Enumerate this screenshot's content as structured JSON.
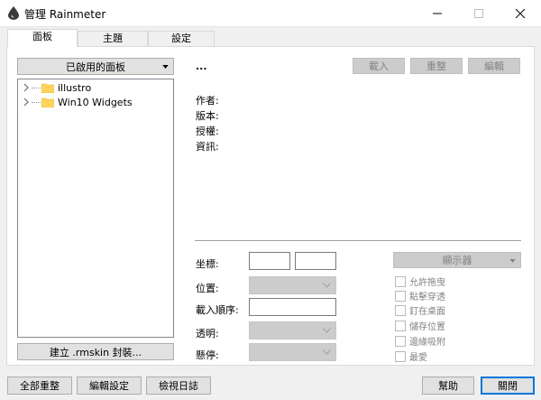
{
  "window": {
    "title": "管理 Rainmeter"
  },
  "tabs": [
    {
      "label": "面板"
    },
    {
      "label": "主題"
    },
    {
      "label": "設定"
    }
  ],
  "skins": {
    "dropdown_label": "已啟用的面板",
    "tree": [
      {
        "label": "illustro"
      },
      {
        "label": "Win10 Widgets"
      }
    ],
    "create_button": "建立 .rmskin 封裝..."
  },
  "details": {
    "name": "...",
    "load_button": "載入",
    "refresh_button": "重整",
    "edit_button": "編輯",
    "author_label": "作者:",
    "version_label": "版本:",
    "license_label": "授權:",
    "info_label": "資訊:"
  },
  "settings": {
    "coordinates_label": "坐標:",
    "position_label": "位置:",
    "load_order_label": "載入順序:",
    "transparency_label": "透明:",
    "hover_label": "懸停:",
    "display_label": "顯示器",
    "checkboxes": [
      {
        "label": "允許拖曳"
      },
      {
        "label": "點擊穿透"
      },
      {
        "label": "釘在桌面"
      },
      {
        "label": "儲存位置"
      },
      {
        "label": "邊緣吸附"
      },
      {
        "label": "最愛"
      }
    ]
  },
  "footer": {
    "refresh_all": "全部重整",
    "edit_settings": "編輯設定",
    "view_log": "檢視日誌",
    "help": "幫助",
    "close": "關閉"
  },
  "colors": {
    "accent": "#0078d7",
    "folder": "#ffd45e",
    "drop_icon": "#3a3a3a"
  }
}
